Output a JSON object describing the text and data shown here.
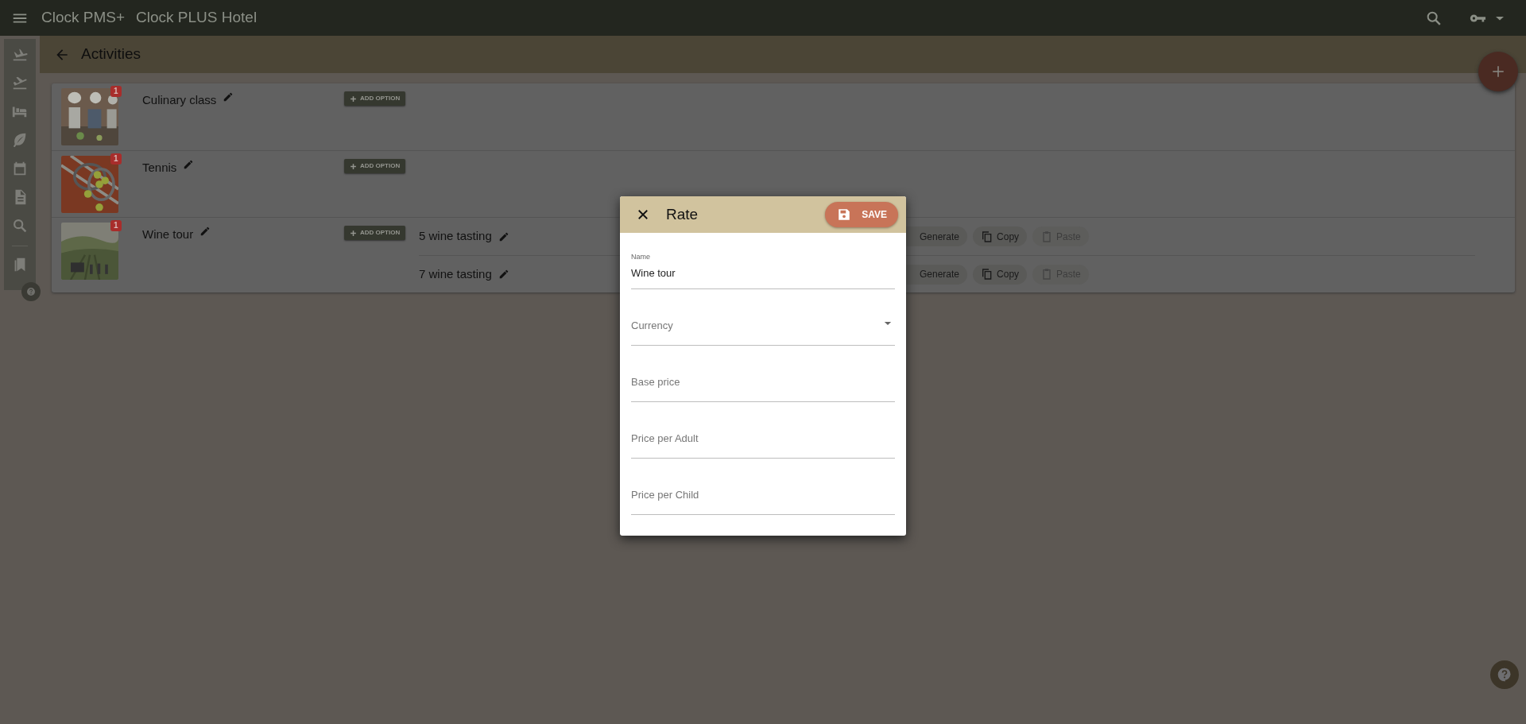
{
  "topbar": {
    "app_name": "Clock PMS+",
    "hotel_name": "Clock PLUS Hotel"
  },
  "page": {
    "title": "Activities"
  },
  "activities": [
    {
      "name": "Culinary class",
      "badge": "1",
      "image": {
        "kind": "picture"
      },
      "add_option_label": "ADD OPTION"
    },
    {
      "name": "Tennis",
      "badge": "1",
      "image": {
        "kind": "picture"
      },
      "add_option_label": "ADD OPTION"
    },
    {
      "name": "Wine tour",
      "badge": "1",
      "image": {
        "kind": "picture"
      },
      "add_option_label": "ADD OPTION",
      "options": [
        {
          "name": "5 wine tasting",
          "actions": [
            {
              "kind": "generate",
              "label": "Generate",
              "disabled": false
            },
            {
              "kind": "copy",
              "label": "Copy",
              "disabled": false
            },
            {
              "kind": "paste",
              "label": "Paste",
              "disabled": true
            }
          ]
        },
        {
          "name": "7 wine tasting",
          "actions": [
            {
              "kind": "generate",
              "label": "Generate",
              "disabled": false
            },
            {
              "kind": "copy",
              "label": "Copy",
              "disabled": false
            },
            {
              "kind": "paste",
              "label": "Paste",
              "disabled": true
            }
          ]
        }
      ]
    }
  ],
  "dialog": {
    "title": "Rate",
    "save_label": "SAVE",
    "fields": [
      {
        "kind": "text",
        "label": "Name",
        "value": "Wine tour"
      },
      {
        "kind": "select",
        "placeholder": "Currency"
      },
      {
        "kind": "text",
        "placeholder": "Base price"
      },
      {
        "kind": "text",
        "placeholder": "Price per Adult"
      },
      {
        "kind": "text",
        "placeholder": "Price per Child"
      }
    ]
  }
}
